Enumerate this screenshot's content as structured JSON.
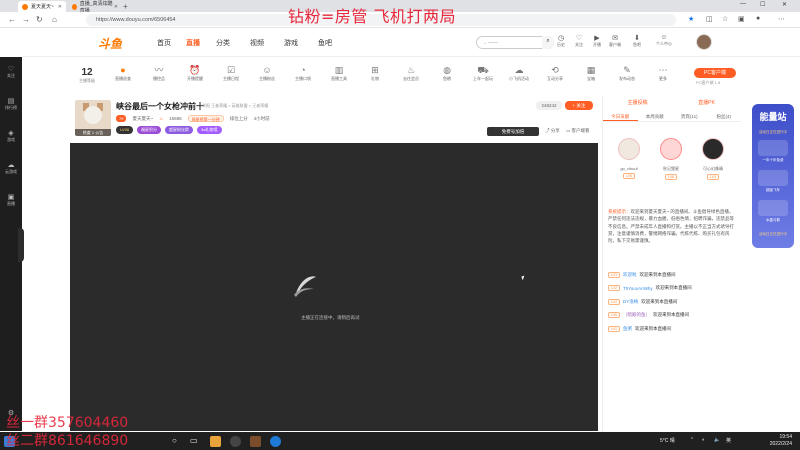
{
  "browser": {
    "tabs": [
      {
        "label": "夏天夏天~",
        "active": true
      },
      {
        "label": "直播_高清炫酷直播",
        "active": false
      }
    ],
    "url": "https://www.douyu.com/6506454"
  },
  "overlay": {
    "top_text": "钻粉=房管 飞机打两局",
    "bottom_line1": "丝一群357604460",
    "bottom_line2": "丝二群861646890"
  },
  "site": {
    "logo": "斗鱼",
    "nav": [
      "首页",
      "直播",
      "分类",
      "视频",
      "游戏",
      "鱼吧"
    ],
    "search_placeholder": "←——",
    "header_icons": [
      {
        "icon": "history-icon",
        "label": "历史"
      },
      {
        "icon": "follow-icon",
        "label": "关注"
      },
      {
        "icon": "live-icon",
        "label": "开播"
      },
      {
        "icon": "message-icon",
        "label": "客户端"
      },
      {
        "icon": "download-icon",
        "label": "鱼吧"
      },
      {
        "icon": "user-icon",
        "label": "个人中心"
      }
    ]
  },
  "sidebar": {
    "items": [
      "关注",
      "排行榜",
      "游戏",
      "云游戏",
      "直播"
    ]
  },
  "toolbar": {
    "level_num": "12",
    "level_label": "主播等级",
    "tools": [
      "直播巡查",
      "播控品",
      "开播提醒",
      "主播日程",
      "主播粉丝",
      "主播口袋",
      "直播工具",
      "礼物",
      "去往会员",
      "鱼粮",
      "上车一起玩",
      "小飞机活动",
      "互动分享",
      "宝箱",
      "发布动态",
      "更多"
    ],
    "pc_button": "PC客户端",
    "pc_sub": "PC客户端 1.8"
  },
  "stream": {
    "title": "峡谷最后一个女枪冲前十",
    "title_meta": "举报  王者荣耀 > 英雄联盟 > 王者荣耀",
    "level_chip": "79",
    "anchor_name": "夏天夏天~",
    "hot": "15686",
    "tag1": "周星榜第一分钟",
    "tag2": "排位上分",
    "tag3": "4小时前",
    "badges": [
      "LV06",
      "福星积分",
      "超星粉丝群",
      "3a礼物墙"
    ],
    "avatar_label": "热度 1 公告",
    "hot_count": "248242",
    "follow_label": "+ 关注",
    "bg_btn": "免费号加倍",
    "share": "分享",
    "report": "客户端看"
  },
  "player": {
    "loading_text": "主播正在连接中，请稍后再试"
  },
  "rpanel": {
    "top_links": [
      "主播投稿",
      "直播PK"
    ],
    "tabs": [
      "今日贡献",
      "本周贡献",
      "贵宾(11)",
      "粉丝(4)"
    ],
    "rank": [
      {
        "name": "go_vihuuf",
        "level": "LV5"
      },
      {
        "name": "秋记狸星",
        "level": "LV6"
      },
      {
        "name": "可心幻像晴",
        "level": "LV3"
      }
    ],
    "sysmsg_label": "系统提示：",
    "sysmsg_text": "欢迎来到夏天夏天~ 的直播间。斗鱼倡导绿色直播，严禁任何违法违规，暴力血腥，低俗色情，招聘诈骗，违禁品等不良信息。严禁未成年人直播和打赏。主播以不正当方式诱导打赏，注意谨慎消费，警惕网络诈骗。代练代练、购买礼包有风险，私下交易需谨慎。",
    "chats": [
      {
        "level": "LV3",
        "nick": "欢迎啦",
        "text": "欢迎来到本直播间",
        "color": "blue"
      },
      {
        "level": "LV2",
        "nick": "ThYouxAnWhy",
        "text": "欢迎来到本直播间",
        "color": "blue"
      },
      {
        "level": "LV2",
        "nick": "DY洛梅",
        "text": "欢迎来到本直播间",
        "color": "blue"
      },
      {
        "level": "LV8",
        "nick": "（暗殿的鱼）",
        "text": "欢迎来到本直播间",
        "color": "purple"
      },
      {
        "level": "LV1",
        "nick": "鱼粥",
        "text": "欢迎来到本直播间",
        "color": "blue"
      }
    ]
  },
  "promo": {
    "title": "能量站",
    "items": [
      "一年十年免费",
      "超级飞车",
      "水晶弓箭"
    ],
    "badge": "活动日正在进行中",
    "bottom": "活动日正在进行中"
  },
  "taskbar": {
    "time": "19:54",
    "date": "2022/2/24",
    "temp": "5°C 晴"
  }
}
